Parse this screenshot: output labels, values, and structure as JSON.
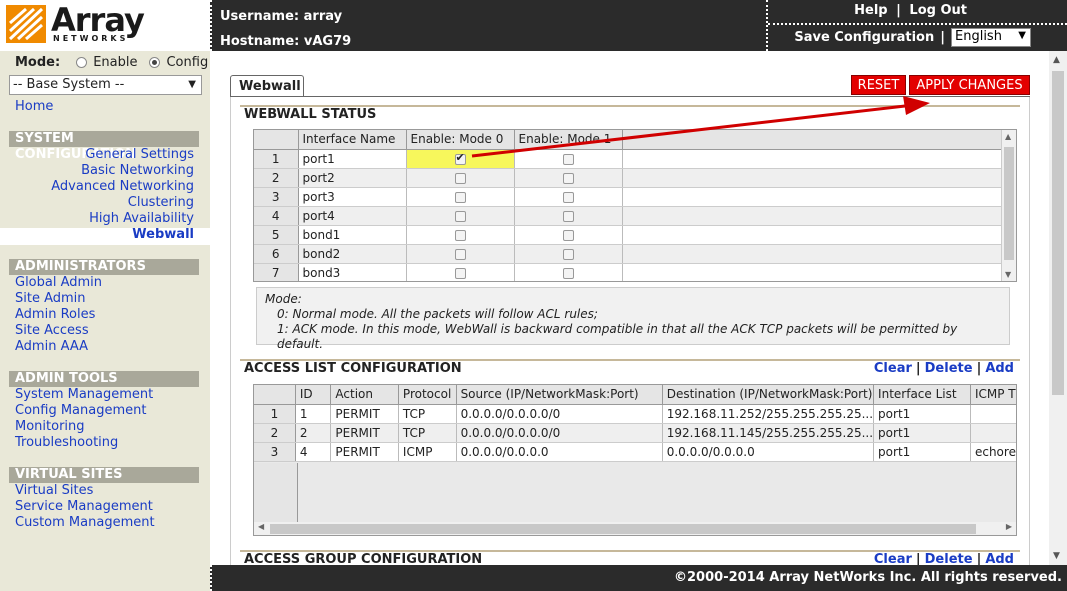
{
  "header": {
    "logo_text": "Array",
    "logo_sub": "NETWORKS",
    "username_label": "Username: array",
    "hostname_label": "Hostname: vAG79",
    "help": "Help",
    "separator": "|",
    "logout": "Log Out",
    "save_config": "Save Configuration",
    "language": "English"
  },
  "sidebar": {
    "mode_label": "Mode:",
    "mode_enable": "Enable",
    "mode_config": "Config",
    "base_system": "-- Base System --",
    "home": "Home",
    "system_config": {
      "title": "SYSTEM CONFIGURATION",
      "items": [
        "General Settings",
        "Basic Networking",
        "Advanced Networking",
        "Clustering",
        "High Availability",
        "Webwall"
      ]
    },
    "administrators": {
      "title": "ADMINISTRATORS",
      "items": [
        "Global Admin",
        "Site Admin",
        "Admin Roles",
        "Site Access",
        "Admin AAA"
      ]
    },
    "admin_tools": {
      "title": "ADMIN TOOLS",
      "items": [
        "System Management",
        "Config Management",
        "Monitoring",
        "Troubleshooting"
      ]
    },
    "virtual_sites": {
      "title": "VIRTUAL SITES",
      "items": [
        "Virtual Sites",
        "Service Management",
        "Custom Management"
      ]
    }
  },
  "main": {
    "tab": "Webwall",
    "reset": "RESET",
    "apply": "APPLY CHANGES",
    "webwall_status": {
      "title": "WEBWALL STATUS",
      "columns": [
        "Interface Name",
        "Enable: Mode 0",
        "Enable: Mode 1"
      ],
      "rows": [
        {
          "n": "1",
          "name": "port1",
          "mode0": true,
          "mode1": false
        },
        {
          "n": "2",
          "name": "port2",
          "mode0": false,
          "mode1": false
        },
        {
          "n": "3",
          "name": "port3",
          "mode0": false,
          "mode1": false
        },
        {
          "n": "4",
          "name": "port4",
          "mode0": false,
          "mode1": false
        },
        {
          "n": "5",
          "name": "bond1",
          "mode0": false,
          "mode1": false
        },
        {
          "n": "6",
          "name": "bond2",
          "mode0": false,
          "mode1": false
        },
        {
          "n": "7",
          "name": "bond3",
          "mode0": false,
          "mode1": false
        }
      ]
    },
    "mode_note": {
      "line1": "Mode:",
      "line2": "0: Normal mode. All the packets will follow ACL rules;",
      "line3": "1: ACK mode. In this mode, WebWall is backward compatible in that all the ACK TCP packets will be permitted by default."
    },
    "acl": {
      "title": "ACCESS LIST CONFIGURATION",
      "clear": "Clear",
      "delete": "Delete",
      "add": "Add",
      "sep": "|",
      "columns": [
        "ID",
        "Action",
        "Protocol",
        "Source (IP/NetworkMask:Port)",
        "Destination (IP/NetworkMask:Port)",
        "Interface List",
        "ICMP T"
      ],
      "rows": [
        {
          "n": "1",
          "id": "1",
          "action": "PERMIT",
          "protocol": "TCP",
          "source": "0.0.0.0/0.0.0.0/0",
          "dest": "192.168.11.252/255.255.255.25...",
          "iface": "port1",
          "icmp": ""
        },
        {
          "n": "2",
          "id": "2",
          "action": "PERMIT",
          "protocol": "TCP",
          "source": "0.0.0.0/0.0.0.0/0",
          "dest": "192.168.11.145/255.255.255.25...",
          "iface": "port1",
          "icmp": ""
        },
        {
          "n": "3",
          "id": "4",
          "action": "PERMIT",
          "protocol": "ICMP",
          "source": "0.0.0.0/0.0.0.0",
          "dest": "0.0.0.0/0.0.0.0",
          "iface": "port1",
          "icmp": "echore"
        }
      ]
    },
    "acg": {
      "title": "ACCESS GROUP CONFIGURATION",
      "clear": "Clear",
      "delete": "Delete",
      "add": "Add"
    }
  },
  "footer": {
    "copyright": "©2000-2014 Array NetWorks Inc. All rights reserved."
  },
  "colors": {
    "header_bg": "#2b2b2b",
    "sidebar_bg": "#e9e8d8",
    "accent_red": "#e30000",
    "logo_orange": "#f08a00",
    "link_blue": "#1a3cc4"
  }
}
